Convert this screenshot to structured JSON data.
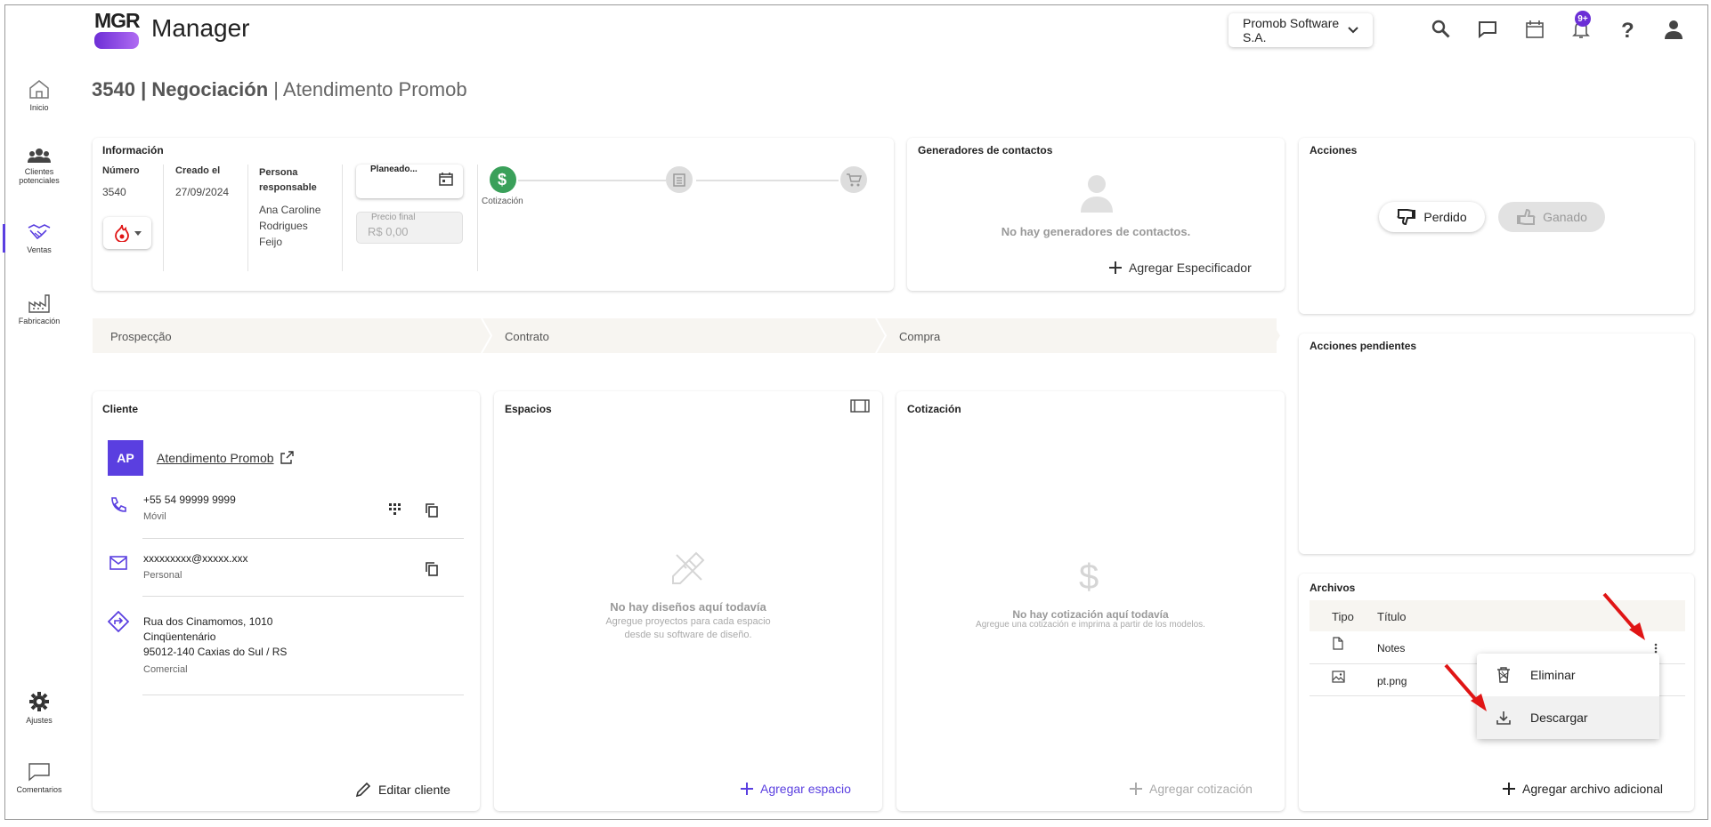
{
  "header": {
    "logo_text": "MGR",
    "app_title": "Manager",
    "company": "Promob Software S.A.",
    "notifications_badge": "9+"
  },
  "sidebar": {
    "items": [
      {
        "label": "Inicio",
        "icon": "home-icon"
      },
      {
        "label": "Clientes potenciales",
        "icon": "people-icon"
      },
      {
        "label": "Ventas",
        "icon": "handshake-icon",
        "active": true
      },
      {
        "label": "Fabricación",
        "icon": "factory-icon"
      },
      {
        "label": "Ajustes",
        "icon": "gear-icon"
      },
      {
        "label": "Comentarios",
        "icon": "chat-icon"
      }
    ]
  },
  "page": {
    "number": "3540",
    "stage": "Negociación",
    "name": "Atendimento Promob"
  },
  "info": {
    "title": "Información",
    "number_label": "Número",
    "number_value": "3540",
    "created_label": "Creado el",
    "created_value": "27/09/2024",
    "responsible_label": "Persona responsable",
    "responsible_value": "Ana Caroline Rodrigues Feijo",
    "planned_label": "Planeado...",
    "final_price_label": "Precio final",
    "final_price_value": "R$ 0,00",
    "step_label": "Cotización"
  },
  "contacts": {
    "title": "Generadores de contactos",
    "empty": "No hay generadores de contactos.",
    "add": "Agregar Especificador"
  },
  "actions": {
    "title": "Acciones",
    "lost": "Perdido",
    "won": "Ganado"
  },
  "pending": {
    "title": "Acciones pendientes"
  },
  "pipeline": {
    "stages": [
      "Prospecção",
      "Contrato",
      "Compra"
    ]
  },
  "client": {
    "title": "Cliente",
    "initials": "AP",
    "name": "Atendimento Promob",
    "phone": "+55 54 99999 9999",
    "phone_type": "Móvil",
    "email": "xxxxxxxxx@xxxxx.xxx",
    "email_type": "Personal",
    "address_line1": "Rua dos Cinamomos, 1010",
    "address_line2": "Cinqüentenário",
    "address_line3": "95012-140 Caxias do Sul / RS",
    "address_type": "Comercial",
    "edit": "Editar cliente"
  },
  "spaces": {
    "title": "Espacios",
    "empty_title": "No hay diseños aquí todavía",
    "empty_sub1": "Agregue proyectos para cada espacio",
    "empty_sub2": "desde su software de diseño.",
    "add": "Agregar espacio"
  },
  "quote": {
    "title": "Cotización",
    "empty_title": "No hay cotización aquí todavía",
    "empty_sub": "Agregue una cotización e imprima a partir de los modelos.",
    "add": "Agregar cotización"
  },
  "files": {
    "title": "Archivos",
    "col_type": "Tipo",
    "col_title": "Título",
    "rows": [
      {
        "type_icon": "file-icon",
        "title": "Notes"
      },
      {
        "type_icon": "image-icon",
        "title": "pt.png"
      }
    ],
    "add": "Agregar archivo adicional",
    "menu": {
      "delete": "Eliminar",
      "download": "Descargar"
    }
  },
  "colors": {
    "accent": "#5a3fe0",
    "success": "#3aa05a",
    "annotation": "#e01515"
  }
}
